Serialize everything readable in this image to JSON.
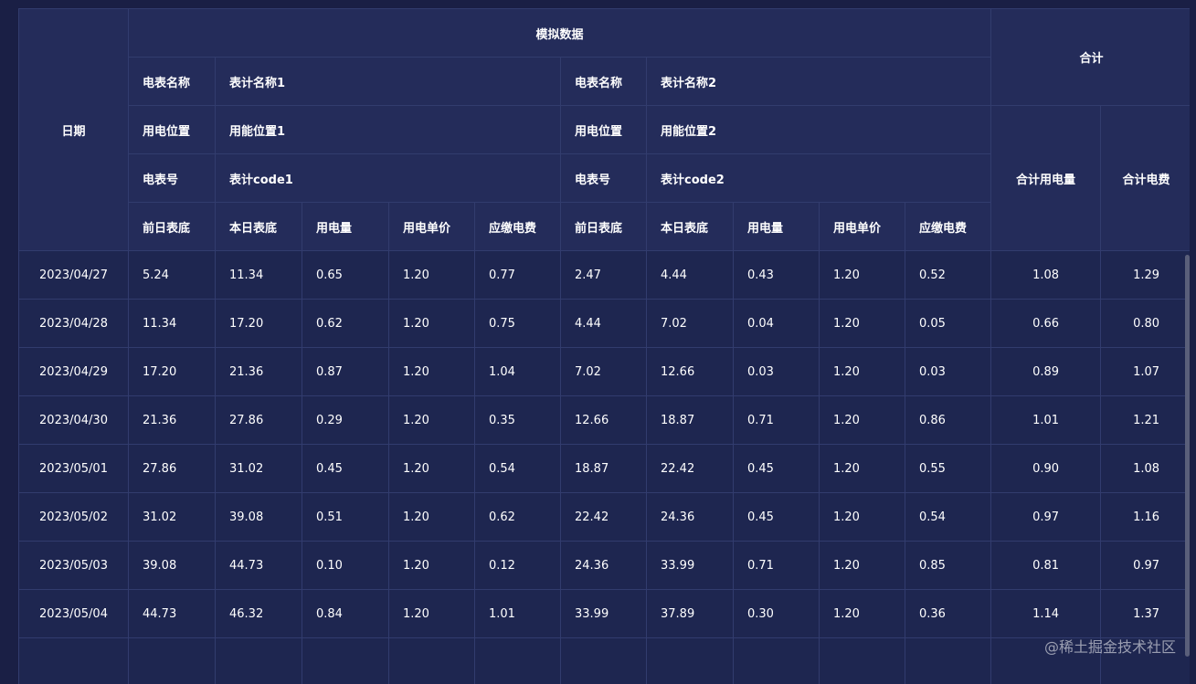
{
  "header": {
    "date": "日期",
    "group_title": "模拟数据",
    "total_title": "合计",
    "total_power": "合计用电量",
    "total_fee": "合计电费",
    "meter1": {
      "name_label": "电表名称",
      "name_value": "表计名称1",
      "pos_label": "用电位置",
      "pos_value": "用能位置1",
      "no_label": "电表号",
      "no_value": "表计code1"
    },
    "meter2": {
      "name_label": "电表名称",
      "name_value": "表计名称2",
      "pos_label": "用电位置",
      "pos_value": "用能位置2",
      "no_label": "电表号",
      "no_value": "表计code2"
    },
    "columns": [
      "前日表底",
      "本日表底",
      "用电量",
      "用电单价",
      "应缴电费",
      "前日表底",
      "本日表底",
      "用电量",
      "用电单价",
      "应缴电费"
    ]
  },
  "rows": [
    {
      "date": "2023/04/27",
      "c": [
        "5.24",
        "11.34",
        "0.65",
        "1.20",
        "0.77",
        "2.47",
        "4.44",
        "0.43",
        "1.20",
        "0.52"
      ],
      "total_power": "1.08",
      "total_fee": "1.29"
    },
    {
      "date": "2023/04/28",
      "c": [
        "11.34",
        "17.20",
        "0.62",
        "1.20",
        "0.75",
        "4.44",
        "7.02",
        "0.04",
        "1.20",
        "0.05"
      ],
      "total_power": "0.66",
      "total_fee": "0.80"
    },
    {
      "date": "2023/04/29",
      "c": [
        "17.20",
        "21.36",
        "0.87",
        "1.20",
        "1.04",
        "7.02",
        "12.66",
        "0.03",
        "1.20",
        "0.03"
      ],
      "total_power": "0.89",
      "total_fee": "1.07"
    },
    {
      "date": "2023/04/30",
      "c": [
        "21.36",
        "27.86",
        "0.29",
        "1.20",
        "0.35",
        "12.66",
        "18.87",
        "0.71",
        "1.20",
        "0.86"
      ],
      "total_power": "1.01",
      "total_fee": "1.21"
    },
    {
      "date": "2023/05/01",
      "c": [
        "27.86",
        "31.02",
        "0.45",
        "1.20",
        "0.54",
        "18.87",
        "22.42",
        "0.45",
        "1.20",
        "0.55"
      ],
      "total_power": "0.90",
      "total_fee": "1.08"
    },
    {
      "date": "2023/05/02",
      "c": [
        "31.02",
        "39.08",
        "0.51",
        "1.20",
        "0.62",
        "22.42",
        "24.36",
        "0.45",
        "1.20",
        "0.54"
      ],
      "total_power": "0.97",
      "total_fee": "1.16"
    },
    {
      "date": "2023/05/03",
      "c": [
        "39.08",
        "44.73",
        "0.10",
        "1.20",
        "0.12",
        "24.36",
        "33.99",
        "0.71",
        "1.20",
        "0.85"
      ],
      "total_power": "0.81",
      "total_fee": "0.97"
    },
    {
      "date": "2023/05/04",
      "c": [
        "44.73",
        "46.32",
        "0.84",
        "1.20",
        "1.01",
        "33.99",
        "37.89",
        "0.30",
        "1.20",
        "0.36"
      ],
      "total_power": "1.14",
      "total_fee": "1.37"
    },
    {
      "date": "",
      "c": [
        "",
        "",
        "",
        "",
        "",
        "",
        "",
        "",
        "",
        ""
      ],
      "total_power": "",
      "total_fee": ""
    }
  ],
  "watermark": "@稀土掘金技术社区"
}
